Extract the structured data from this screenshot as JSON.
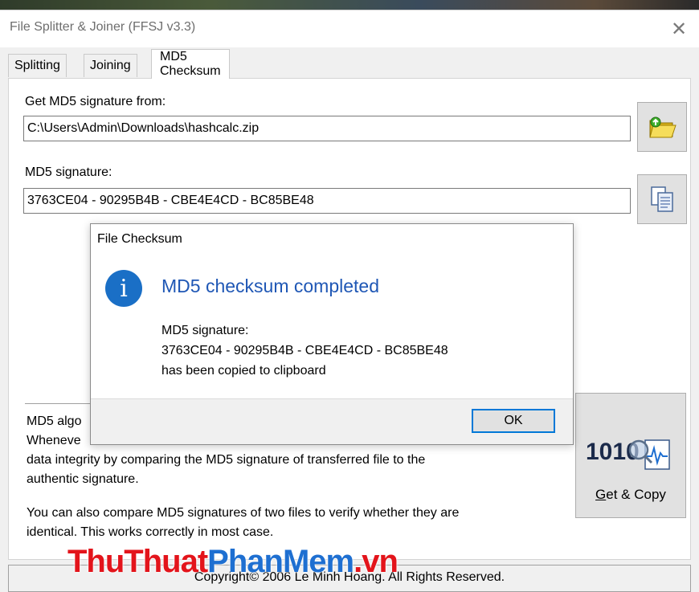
{
  "window": {
    "title": "File Splitter & Joiner (FFSJ v3.3)",
    "close_glyph": "✕"
  },
  "tabs": [
    {
      "label": "Splitting"
    },
    {
      "label": "Joining"
    },
    {
      "label": "MD5 Checksum"
    }
  ],
  "checksum": {
    "source_label": "Get MD5 signature from:",
    "source_value": "C:\\Users\\Admin\\Downloads\\hashcalc.zip",
    "signature_label": "MD5 signature:",
    "signature_value": "3763CE04 - 90295B4B - CBE4E4CD - BC85BE48",
    "browse_icon": "folder-open-icon",
    "copy_icon": "copy-documents-icon",
    "info_line1_visible": "MD5 algo",
    "info_line2_visible": "Wheneve",
    "info_line3": "data integrity by comparing the MD5 signature of transferred file to the",
    "info_line4": "authentic signature.",
    "compare_line1": "You can also compare MD5 signatures of two files to verify whether they are",
    "compare_line2": "identical. This works correctly in most case.",
    "get_copy_label": "Get & Copy",
    "get_copy_underline": "G",
    "get_copy_rest": "et & Copy",
    "get_copy_icon_text": "1010",
    "get_copy_icon": "binary-magnifier-icon"
  },
  "status": {
    "copyright": "Copyright© 2006 Le Minh Hoang. All Rights Reserved."
  },
  "dialog": {
    "title": "File Checksum",
    "icon": "info-icon",
    "icon_glyph": "i",
    "heading": "MD5 checksum completed",
    "line1": "MD5 signature:",
    "line2": "3763CE04 - 90295B4B - CBE4E4CD - BC85BE48",
    "line3": "has been copied to clipboard",
    "ok_label": "OK"
  },
  "watermark": {
    "part1": "ThuThuat",
    "part2": "PhanMem",
    "part3": ".vn"
  },
  "colors": {
    "accent": "#0078d7",
    "heading_blue": "#1f57b5",
    "info_icon": "#1a6fc6",
    "watermark_red": "#e3141b",
    "watermark_blue": "#1e6fd1"
  }
}
